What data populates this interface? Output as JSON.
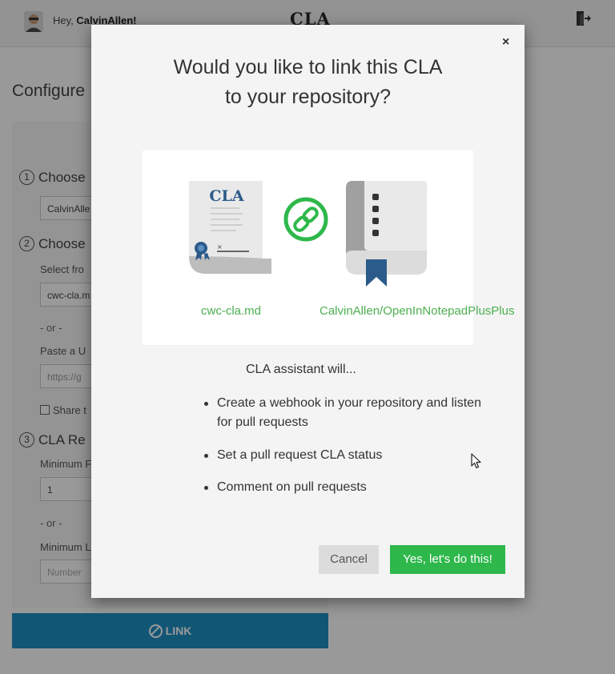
{
  "header": {
    "greeting_prefix": "Hey, ",
    "username": "CalvinAllen!",
    "brand": "CLA"
  },
  "background": {
    "page_title": "Configure",
    "step1": {
      "num": "1",
      "label": "Choose",
      "input_value": "CalvinAlle"
    },
    "step2": {
      "num": "2",
      "label": "Choose",
      "select_label": "Select fro",
      "select_value": "cwc-cla.m",
      "or": "- or -",
      "paste_label": "Paste a U",
      "url_placeholder": "https://g",
      "share_label": "Share t"
    },
    "step3": {
      "num": "3",
      "label": "CLA Re",
      "min_label": "Minimum F",
      "min_value": "1",
      "or": "- or -",
      "min2_label": "Minimum L",
      "number_placeholder": "Number"
    },
    "link_button": "LINK"
  },
  "modal": {
    "close": "×",
    "title_line1": "Would you like to link this CLA",
    "title_line2": "to your repository?",
    "doc_title": "CLA",
    "doc_caption": "cwc-cla.md",
    "repo_caption": "CalvinAllen/OpenInNotepadPlusPlus",
    "assistant_intro": "CLA assistant will...",
    "bullets": [
      "Create a webhook in your repository and listen for pull requests",
      "Set a pull request CLA status",
      "Comment on pull requests"
    ],
    "cancel_label": "Cancel",
    "confirm_label": "Yes, let's do this!"
  },
  "colors": {
    "accent_blue": "#1e8fc5",
    "success_green": "#2eb84b",
    "caption_green": "#4caf50"
  }
}
